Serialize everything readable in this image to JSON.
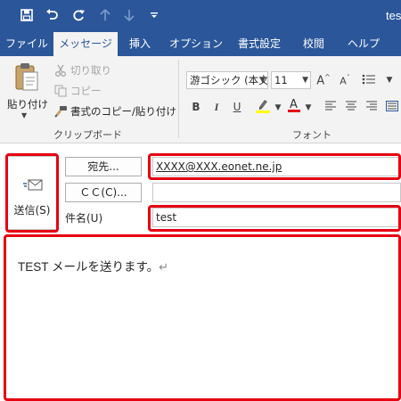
{
  "window": {
    "title": "test"
  },
  "qat": {
    "save_icon": "save-icon",
    "undo_icon": "undo-icon",
    "redo_icon": "redo-icon",
    "up_icon": "up-arrow-icon",
    "down_icon": "down-arrow-icon",
    "customize_icon": "customize-qat-icon"
  },
  "tabs": [
    {
      "label": "ファイル",
      "active": false
    },
    {
      "label": "メッセージ",
      "active": true
    },
    {
      "label": "挿入",
      "active": false
    },
    {
      "label": "オプション",
      "active": false
    },
    {
      "label": "書式設定",
      "active": false
    },
    {
      "label": "校閲",
      "active": false
    },
    {
      "label": "ヘルプ",
      "active": false
    }
  ],
  "ribbon": {
    "clipboard": {
      "paste_label": "貼り付け",
      "cut_label": "切り取り",
      "copy_label": "コピー",
      "format_painter_label": "書式のコピー/貼り付け",
      "group_label": "クリップボード"
    },
    "font": {
      "font_name": "游ゴシック (本文",
      "font_size": "11",
      "group_label": "フォント",
      "bold": "B",
      "italic": "I",
      "underline": "U",
      "highlight_color": "#ffff00",
      "font_color": "#e60012"
    }
  },
  "compose": {
    "send_label": "送信(S)",
    "to_button": "宛先...",
    "cc_button": "ＣＣ(C)...",
    "subject_label": "件名(U)",
    "to_value": "XXXX@XXX.eonet.ne.jp",
    "cc_value": "",
    "subject_value": "test",
    "body_text": "TEST メールを送ります。"
  },
  "colors": {
    "accent": "#2b579a",
    "ribbon_bg": "#f3f3f3",
    "highlight": "#e60012"
  }
}
